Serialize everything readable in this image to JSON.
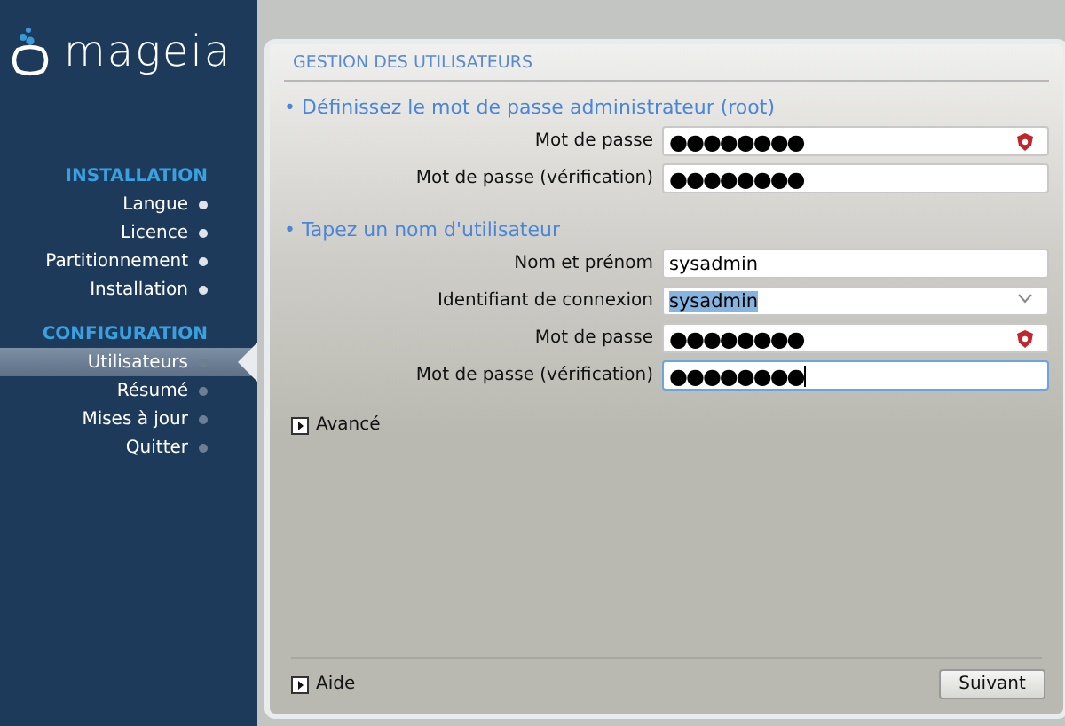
{
  "logo": {
    "text": "mageia"
  },
  "sidebar": {
    "sections": [
      {
        "title": "INSTALLATION",
        "items": [
          {
            "label": "Langue",
            "done": true,
            "selected": false
          },
          {
            "label": "Licence",
            "done": true,
            "selected": false
          },
          {
            "label": "Partitionnement",
            "done": true,
            "selected": false
          },
          {
            "label": "Installation",
            "done": true,
            "selected": false
          }
        ]
      },
      {
        "title": "CONFIGURATION",
        "items": [
          {
            "label": "Utilisateurs",
            "done": false,
            "selected": true
          },
          {
            "label": "Résumé",
            "done": false,
            "selected": false
          },
          {
            "label": "Mises à jour",
            "done": false,
            "selected": false
          },
          {
            "label": "Quitter",
            "done": false,
            "selected": false
          }
        ]
      }
    ]
  },
  "panel": {
    "title": "GESTION DES UTILISATEURS",
    "groups": [
      {
        "heading": "• Définissez le mot de passe administrateur (root)",
        "fields": [
          {
            "label": "Mot de passe",
            "kind": "password",
            "value": "●●●●●●●●",
            "focused": false,
            "selected": false
          },
          {
            "label": "Mot de passe (vérification)",
            "kind": "confirm",
            "value": "●●●●●●●●",
            "focused": false,
            "selected": false
          }
        ]
      },
      {
        "heading": "• Tapez un nom d'utilisateur",
        "fields": [
          {
            "label": "Nom et prénom",
            "kind": "text",
            "value": "sysadmin",
            "focused": false,
            "selected": false
          },
          {
            "label": "Identifiant de connexion",
            "kind": "combo",
            "value": "sysadmin",
            "focused": false,
            "selected": true
          },
          {
            "label": "Mot de passe",
            "kind": "password",
            "value": "●●●●●●●●",
            "focused": false,
            "selected": false
          },
          {
            "label": "Mot de passe (vérification)",
            "kind": "confirm",
            "value": "●●●●●●●●",
            "focused": true,
            "selected": false
          }
        ]
      }
    ],
    "advanced": {
      "label": "Avancé",
      "expanded": false
    },
    "help": {
      "label": "Aide",
      "expanded": false
    },
    "next_button": "Suivant"
  }
}
